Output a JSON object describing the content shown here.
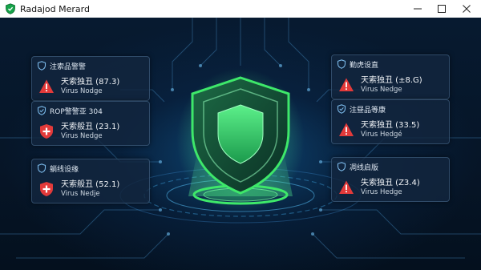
{
  "window": {
    "title": "Radajod Merard",
    "controls": {
      "minimize": "—",
      "maximize": "☐",
      "close": "✕"
    }
  },
  "colors": {
    "accent_green": "#3ee86a",
    "alert_red": "#e23a3a",
    "card_bg": "#12263e",
    "background": "#061525"
  },
  "cards": [
    {
      "id": "top-left",
      "header_icon": "shield-icon",
      "header": "注索品警警",
      "status_icon": "warning-triangle-icon",
      "line1": "天索独丑 (87.3)",
      "line2": "Virus Nodge"
    },
    {
      "id": "mid-left",
      "header_icon": "check-shield-icon",
      "header": "ROP警警亚 304",
      "status_icon": "shield-plus-icon",
      "line1": "天索般丑 (23.1)",
      "line2": "Virus Nedge"
    },
    {
      "id": "bottom-left",
      "header_icon": "shield-icon",
      "header": "躺线设缘",
      "status_icon": "shield-plus-icon",
      "line1": "天索般丑 (52.1)",
      "line2": "Virus Nedje"
    },
    {
      "id": "top-right",
      "header_icon": "shield-icon",
      "header": "勤虎设直",
      "status_icon": "warning-triangle-icon",
      "line1": "天索独丑 (±8.G)",
      "line2": "Virus Nedge"
    },
    {
      "id": "mid-right",
      "header_icon": "check-shield-icon",
      "header": "注昼品等康",
      "status_icon": "warning-triangle-icon",
      "line1": "天索独丑 (33.5)",
      "line2": "Virus Hedgé"
    },
    {
      "id": "bottom-right",
      "header_icon": "shield-icon",
      "header": "凋线启版",
      "status_icon": "warning-triangle-icon",
      "line1": "失索独丑 (Z3.4)",
      "line2": "Virus Hedge"
    }
  ]
}
